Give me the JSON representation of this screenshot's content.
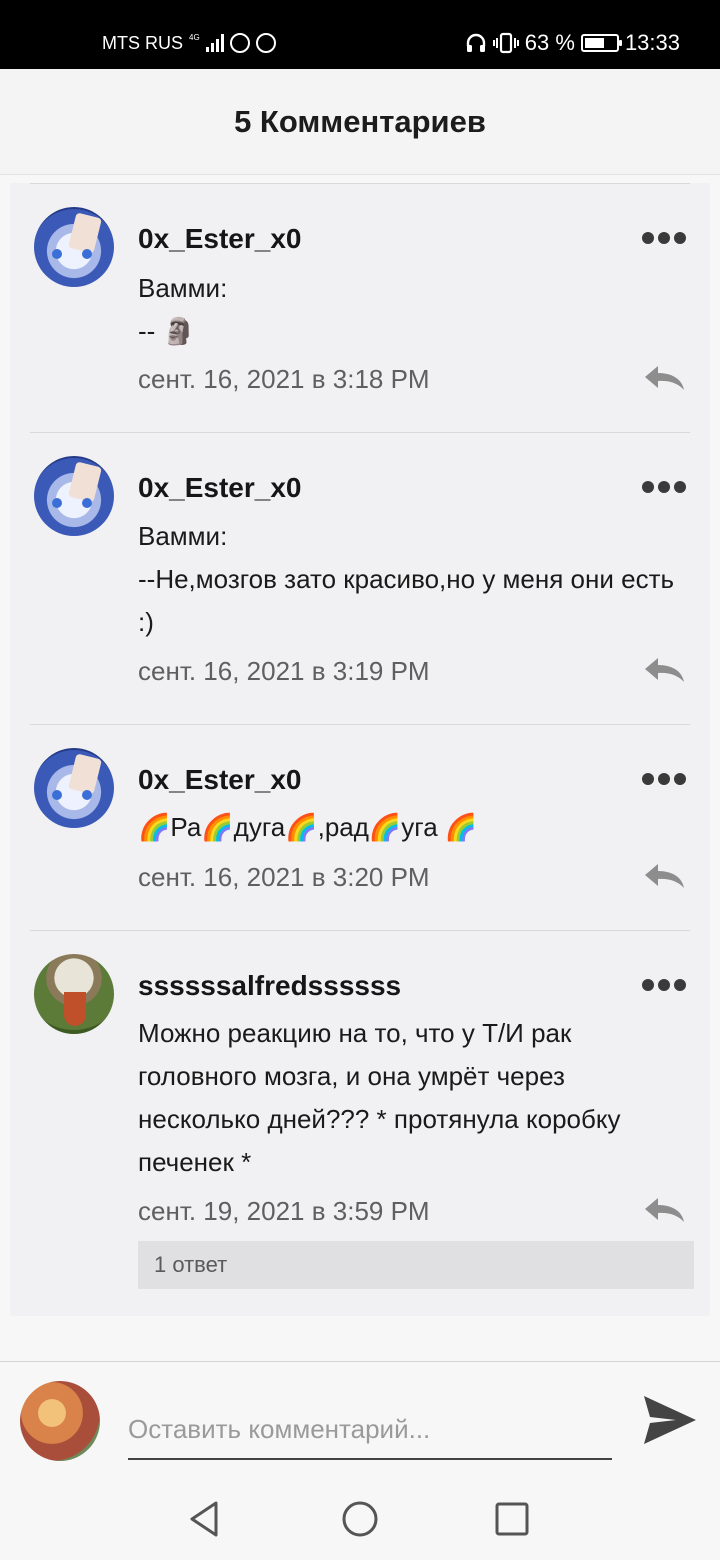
{
  "status_bar": {
    "carrier": "MTS RUS",
    "network": "4G",
    "battery": "63 %",
    "battery_level": 0.63,
    "time": "13:33"
  },
  "header": {
    "title": "5 Комментариев"
  },
  "comments": [
    {
      "author": "0x_Ester_x0",
      "text": "Вамми:\n-- 🗿",
      "date": "сент. 16, 2021 в 3:18 PM"
    },
    {
      "author": "0x_Ester_x0",
      "text": "Вамми:\n--Не,мозгов зато красиво,но у меня они есть :)",
      "date": "сент. 16, 2021 в 3:19 PM"
    },
    {
      "author": "0x_Ester_x0",
      "text": "🌈Ра🌈дуга🌈,рад🌈уга 🌈",
      "date": "сент. 16, 2021 в 3:20 PM"
    },
    {
      "author": "ssssssalfredssssss",
      "text": "Можно реакцию на то, что у Т/И рак головного мозга, и она умрёт через несколько дней??? * протянула коробку печенек *",
      "date": "сент. 19, 2021 в 3:59 PM",
      "replies_label": "1 ответ"
    }
  ],
  "composer": {
    "placeholder": "Оставить комментарий..."
  },
  "icons": {
    "more": "more-dots-icon",
    "reply": "reply-icon",
    "send": "send-icon",
    "back": "nav-back-icon",
    "home": "nav-home-icon",
    "recents": "nav-recents-icon"
  }
}
